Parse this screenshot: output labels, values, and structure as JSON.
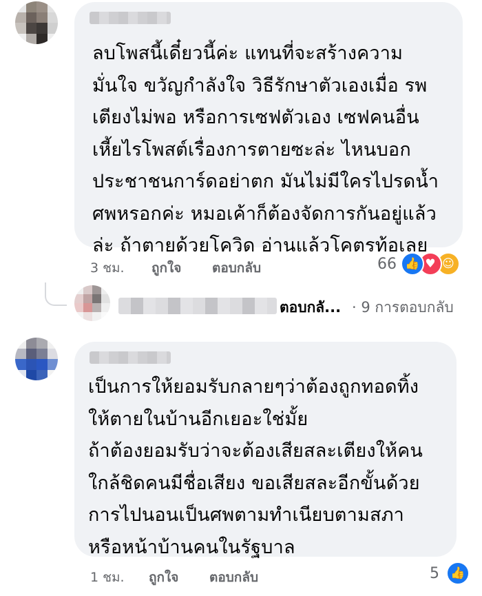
{
  "comments": [
    {
      "text": "ลบโพสนี้เดี๋ยวนี้ค่ะ แทนที่จะสร้างความ\nมั่นใจ ขวัญกำลังใจ วิธีรักษาตัวเองเมื่อ รพ\nเตียงไม่พอ หรือการเซฟตัวเอง เซฟคนอื่น\nเหี้ยไรโพสต์เรื่องการตายซะล่ะ ไหนบอก\nประชาชนการ์ดอย่าตก มันไม่มีใครไปรดน้ำ\nศพหรอกค่ะ หมอเค้าก็ต้องจัดการกันอยู่แล้ว\nล่ะ ถ้าตายด้วยโควิด อ่านแล้วโคตรท้อเลย",
      "time": "3 ชม.",
      "like_label": "ถูกใจ",
      "reply_label": "ตอบกลับ",
      "reaction_count": "66",
      "reactions": [
        "like-icon",
        "love-icon",
        "care-icon"
      ]
    },
    {
      "text": "เป็นการให้ยอมรับกลายๆว่าต้องถูกทอดทิ้ง\nให้ตายในบ้านอีกเยอะใช่มั้ย\nถ้าต้องยอมรับว่าจะต้องเสียสละเตียงให้คน\nใกล้ชิดคนมีชื่อเสียง ขอเสียสละอีกขั้นด้วย\nการไปนอนเป็นศพตามทำเนียบตามสภา\nหรือหน้าบ้านคนในรัฐบาล",
      "time": "1 ชม.",
      "like_label": "ถูกใจ",
      "reply_label": "ตอบกลับ",
      "reaction_count": "5",
      "reactions": [
        "like-icon"
      ]
    }
  ],
  "reply_thread": {
    "label": "ตอบกลั...",
    "count_text": "· 9 การตอบกลับ"
  },
  "colors": {
    "bubble": "#f0f2f5",
    "meta": "#65676b",
    "like": "#1877f2",
    "love": "#f33e58",
    "care": "#f7b125"
  }
}
